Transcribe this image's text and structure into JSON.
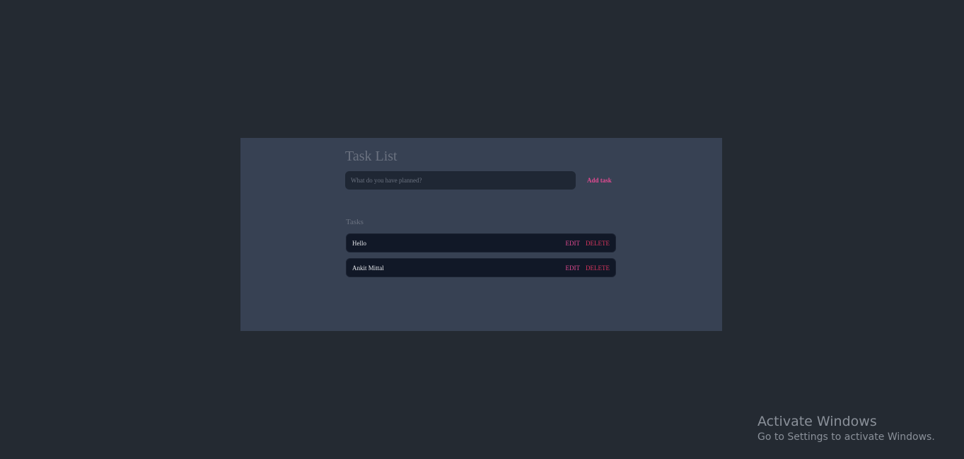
{
  "app": {
    "title": "Task List",
    "input": {
      "placeholder": "What do you have planned?",
      "value": ""
    },
    "add_button_label": "Add task",
    "section_title": "Tasks",
    "tasks": [
      {
        "text": "Hello",
        "edit_label": "EDIT",
        "delete_label": "DELETE"
      },
      {
        "text": "Ankit Mittal",
        "edit_label": "EDIT",
        "delete_label": "DELETE"
      }
    ]
  },
  "watermark": {
    "title": "Activate Windows",
    "subtitle": "Go to Settings to activate Windows."
  },
  "colors": {
    "background": "#242a32",
    "panel": "#374153",
    "input_bg": "#1f2734",
    "task_bg": "#111827",
    "accent_pink": "#e04a91",
    "delete_red": "#d9365e",
    "muted_text": "#6b7280"
  }
}
